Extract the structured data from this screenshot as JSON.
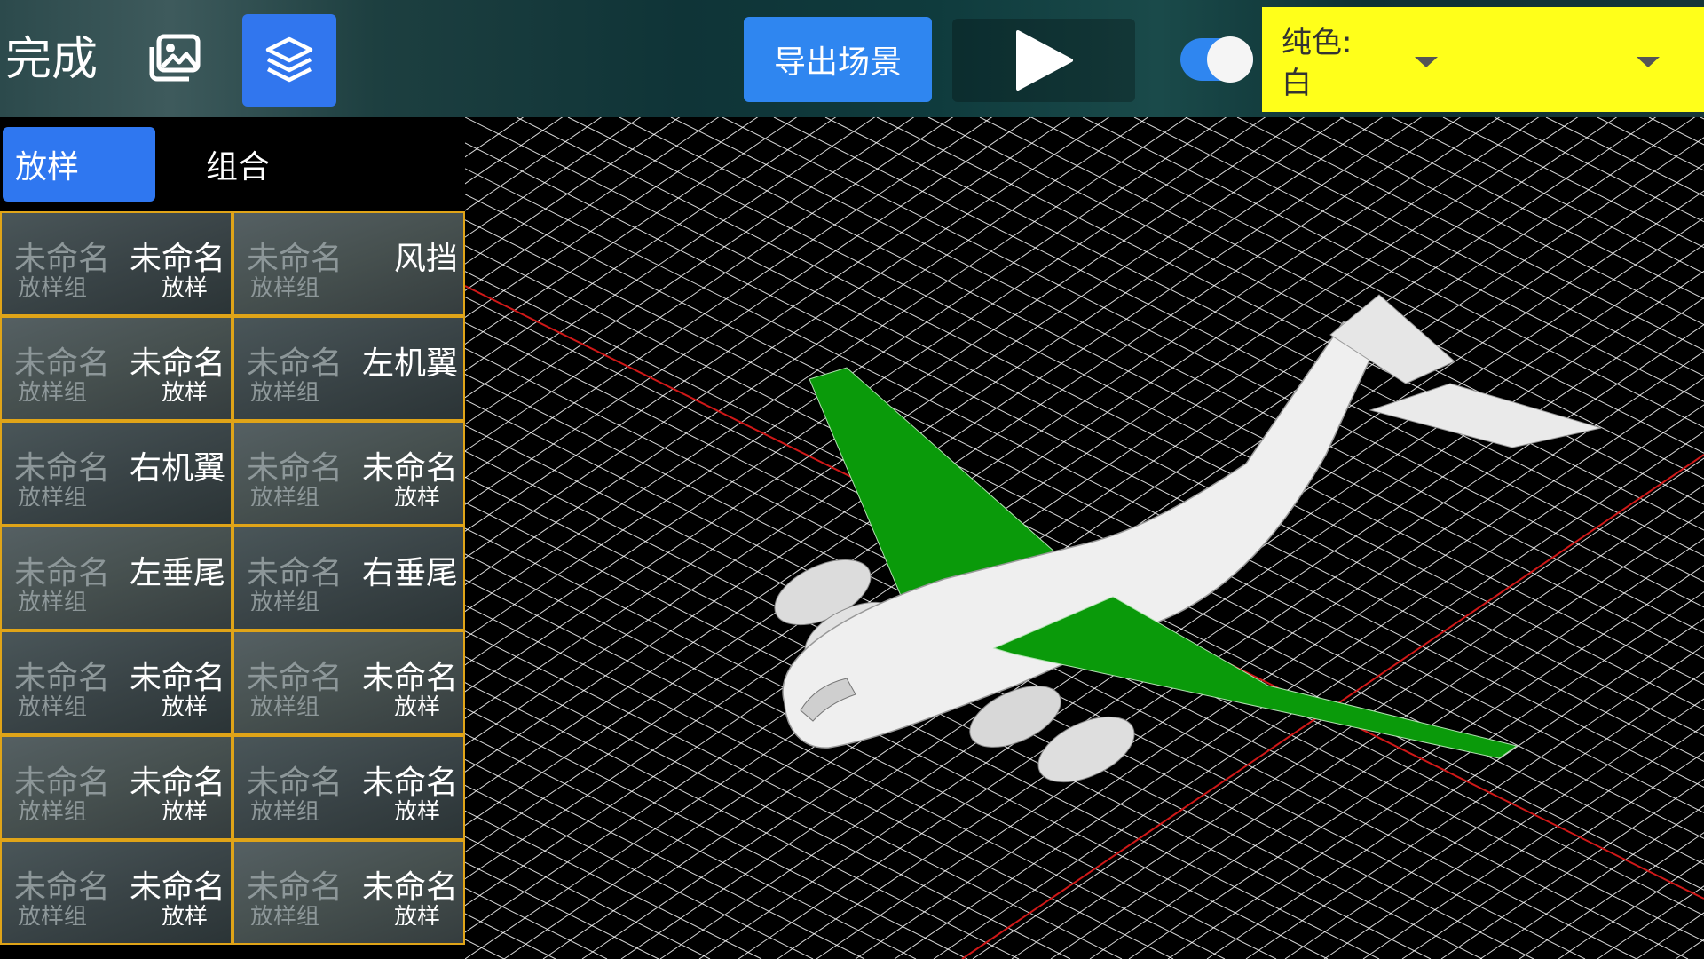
{
  "toolbar": {
    "done_label": "完成",
    "gallery_icon": "image-gallery-icon",
    "layers_icon": "layers-icon",
    "export_label": "导出场景",
    "play_icon": "play-icon",
    "toggle_on": true,
    "accent": "#2f86f0"
  },
  "color_select": {
    "label": "纯色:",
    "value": "白",
    "background": "#ffff1a"
  },
  "tabs": [
    {
      "label": "放样",
      "active": true
    },
    {
      "label": "组合",
      "active": false
    }
  ],
  "parts": [
    {
      "left_name": "未命名",
      "left_sub": "放样组",
      "right_name": "未命名",
      "right_sub": "放样"
    },
    {
      "left_name": "未命名",
      "left_sub": "放样组",
      "right_name": "风挡",
      "right_sub": ""
    },
    {
      "left_name": "未命名",
      "left_sub": "放样组",
      "right_name": "未命名",
      "right_sub": "放样"
    },
    {
      "left_name": "未命名",
      "left_sub": "放样组",
      "right_name": "左机翼",
      "right_sub": ""
    },
    {
      "left_name": "未命名",
      "left_sub": "放样组",
      "right_name": "右机翼",
      "right_sub": ""
    },
    {
      "left_name": "未命名",
      "left_sub": "放样组",
      "right_name": "未命名",
      "right_sub": "放样"
    },
    {
      "left_name": "未命名",
      "left_sub": "放样组",
      "right_name": "左垂尾",
      "right_sub": ""
    },
    {
      "left_name": "未命名",
      "left_sub": "放样组",
      "right_name": "右垂尾",
      "right_sub": ""
    },
    {
      "left_name": "未命名",
      "left_sub": "放样组",
      "right_name": "未命名",
      "right_sub": "放样"
    },
    {
      "left_name": "未命名",
      "left_sub": "放样组",
      "right_name": "未命名",
      "right_sub": "放样"
    },
    {
      "left_name": "未命名",
      "left_sub": "放样组",
      "right_name": "未命名",
      "right_sub": "放样"
    },
    {
      "left_name": "未命名",
      "left_sub": "放样组",
      "right_name": "未命名",
      "right_sub": "放样"
    },
    {
      "left_name": "未命名",
      "left_sub": "放样组",
      "right_name": "未命名",
      "right_sub": "放样"
    },
    {
      "left_name": "未命名",
      "left_sub": "放样组",
      "right_name": "未命名",
      "right_sub": "放样"
    }
  ],
  "viewport": {
    "grid_color": "#ffffff",
    "axis_color": "#d01818",
    "highlight_color": "#0a9a0a",
    "model_color": "#eeeeee"
  }
}
